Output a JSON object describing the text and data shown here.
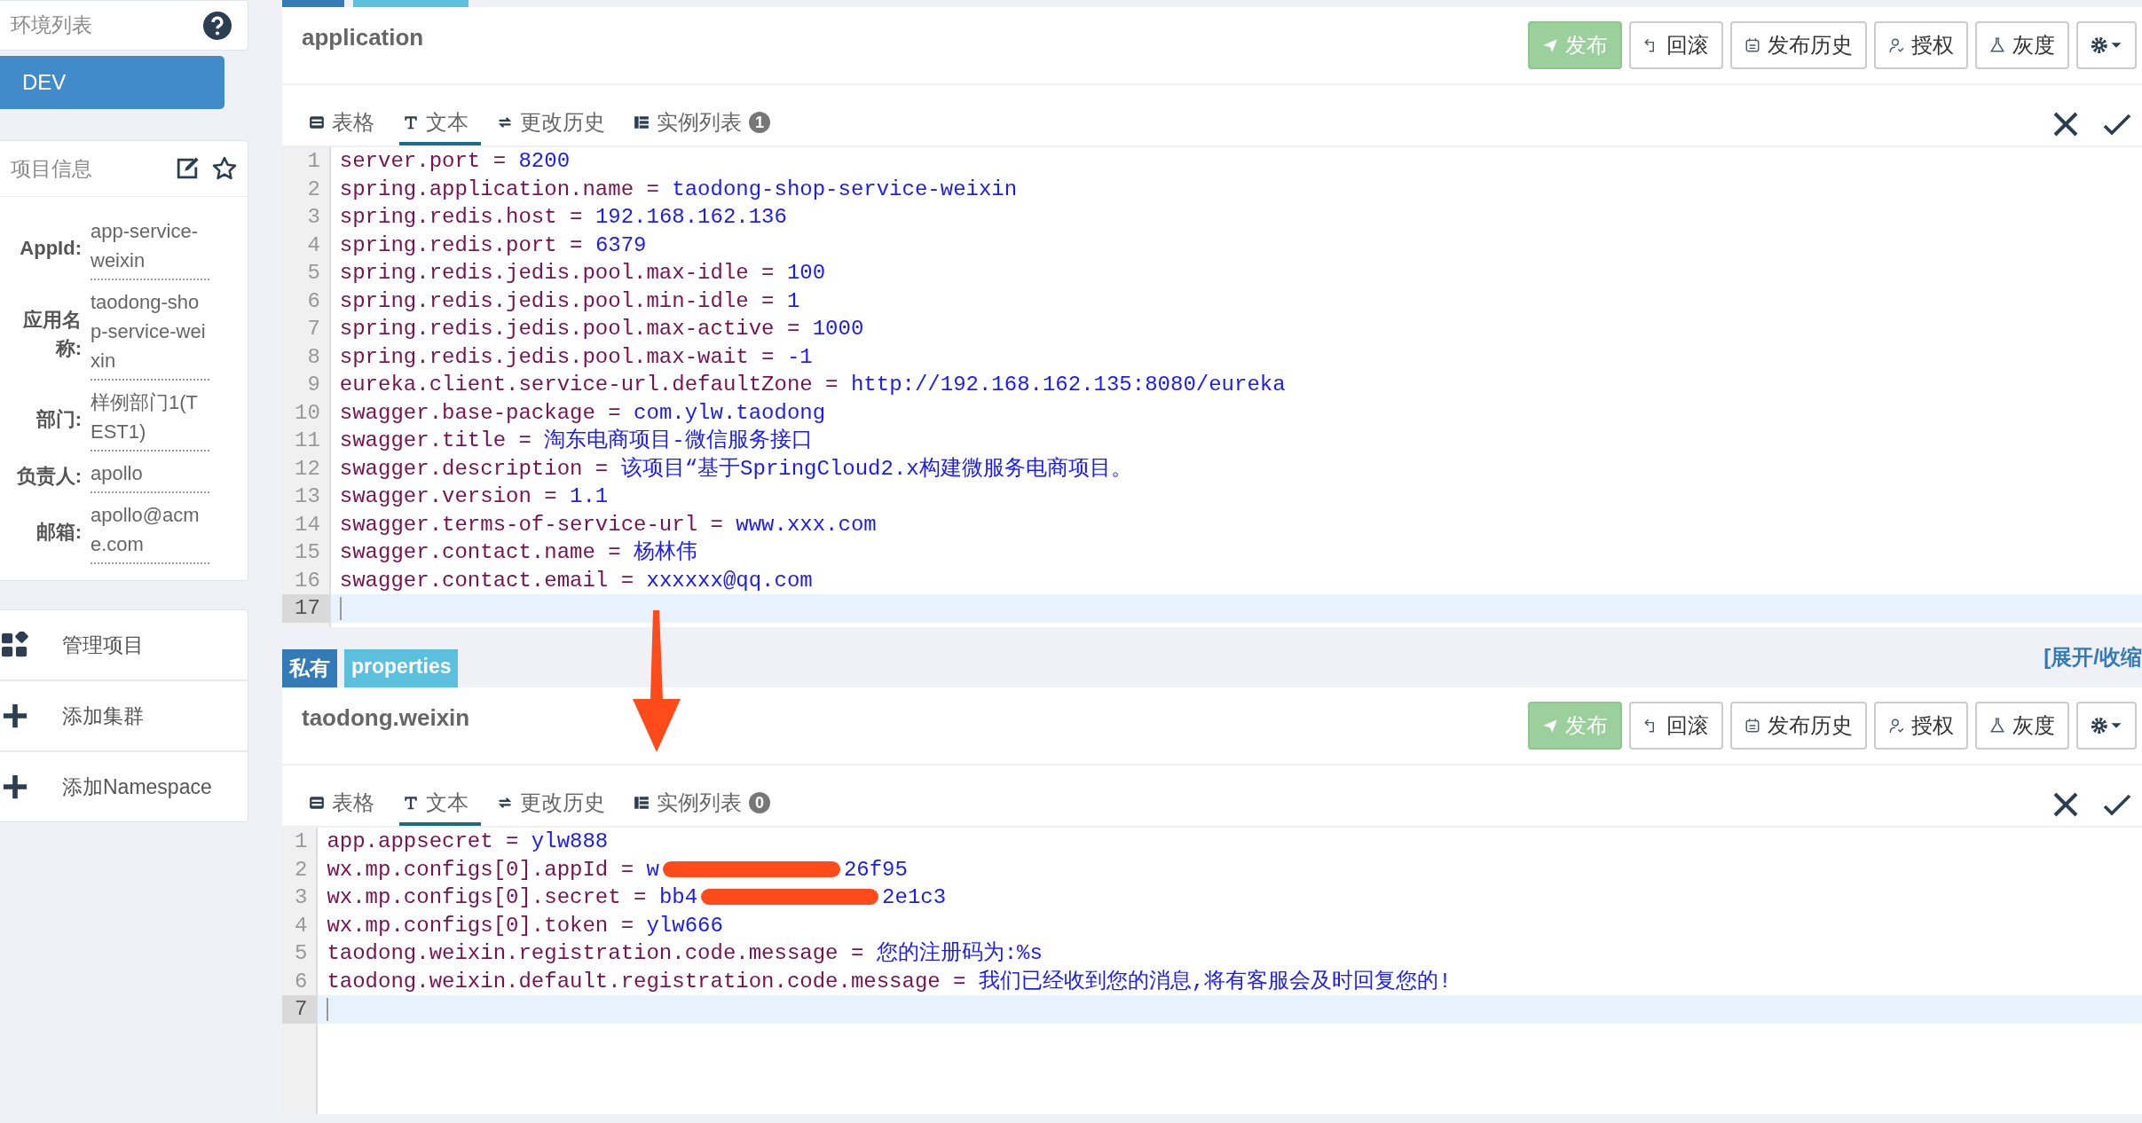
{
  "sidebar": {
    "env_list": {
      "title": "环境列表",
      "items": [
        {
          "label": "DEV",
          "selected": true
        }
      ]
    },
    "project_info": {
      "title": "项目信息",
      "fields": [
        {
          "label": "AppId:",
          "value": "app-service-weixin"
        },
        {
          "label": "应用名称:",
          "value": "taodong-shop-service-weixin"
        },
        {
          "label": "部门:",
          "value": "样例部门1(TEST1)"
        },
        {
          "label": "负责人:",
          "value": "apollo"
        },
        {
          "label": "邮箱:",
          "value": "apollo@acme.com"
        }
      ]
    },
    "actions": [
      {
        "label": "管理项目",
        "kind": "grid"
      },
      {
        "label": "添加集群",
        "kind": "plus"
      },
      {
        "label": "添加Namespace",
        "kind": "plus"
      }
    ]
  },
  "namespaces": [
    {
      "title": "application",
      "buttons": [
        {
          "label": "发布",
          "kind": "primary"
        },
        {
          "label": "回滚",
          "kind": "default"
        },
        {
          "label": "发布历史",
          "kind": "default"
        },
        {
          "label": "授权",
          "kind": "default"
        },
        {
          "label": "灰度",
          "kind": "default"
        },
        {
          "kind": "settings"
        }
      ],
      "tabs": [
        {
          "label": "表格",
          "selected": false
        },
        {
          "label": "文本",
          "selected": true
        },
        {
          "label": "更改历史",
          "selected": false
        },
        {
          "label": "实例列表",
          "selected": false,
          "badge": "1"
        }
      ],
      "lines": [
        {
          "number": "1",
          "key": "server.port =",
          "value": "8200",
          "current": false
        },
        {
          "number": "2",
          "key": "spring.application.name =",
          "value": "taodong-shop-service-weixin",
          "current": false
        },
        {
          "number": "3",
          "key": "spring.redis.host =",
          "value": "192.168.162.136",
          "current": false
        },
        {
          "number": "4",
          "key": "spring.redis.port =",
          "value": "6379",
          "current": false
        },
        {
          "number": "5",
          "key": "spring.redis.jedis.pool.max-idle =",
          "value": "100",
          "current": false
        },
        {
          "number": "6",
          "key": "spring.redis.jedis.pool.min-idle =",
          "value": "1",
          "current": false
        },
        {
          "number": "7",
          "key": "spring.redis.jedis.pool.max-active =",
          "value": "1000",
          "current": false
        },
        {
          "number": "8",
          "key": "spring.redis.jedis.pool.max-wait =",
          "value": "-1",
          "current": false
        },
        {
          "number": "9",
          "key": "eureka.client.service-url.defaultZone =",
          "value": "http://192.168.162.135:8080/eureka",
          "current": false
        },
        {
          "number": "10",
          "key": "swagger.base-package =",
          "value": "com.ylw.taodong",
          "current": false
        },
        {
          "number": "11",
          "key": "swagger.title =",
          "value": "淘东电商项目-微信服务接口",
          "current": false
        },
        {
          "number": "12",
          "key": "swagger.description =",
          "value": "该项目“基于SpringCloud2.x构建微服务电商项目。",
          "current": false
        },
        {
          "number": "13",
          "key": "swagger.version =",
          "value": "1.1",
          "current": false
        },
        {
          "number": "14",
          "key": "swagger.terms-of-service-url =",
          "value": "www.xxx.com",
          "current": false
        },
        {
          "number": "15",
          "key": "swagger.contact.name =",
          "value": "杨林伟",
          "current": false
        },
        {
          "number": "16",
          "key": "swagger.contact.email =",
          "value": "xxxxxx@qq.com",
          "current": false
        },
        {
          "number": "17",
          "current": true
        }
      ]
    },
    {
      "badges": [
        {
          "label": "私有",
          "kind": "scope"
        },
        {
          "label": "properties",
          "kind": "format"
        }
      ],
      "expand_link": "[展开/收缩",
      "title": "taodong.weixin",
      "buttons": [
        {
          "label": "发布",
          "kind": "primary"
        },
        {
          "label": "回滚",
          "kind": "default"
        },
        {
          "label": "发布历史",
          "kind": "default"
        },
        {
          "label": "授权",
          "kind": "default"
        },
        {
          "label": "灰度",
          "kind": "default"
        },
        {
          "kind": "settings"
        }
      ],
      "tabs": [
        {
          "label": "表格",
          "selected": false
        },
        {
          "label": "文本",
          "selected": true
        },
        {
          "label": "更改历史",
          "selected": false
        },
        {
          "label": "实例列表",
          "selected": false,
          "badge": "0"
        }
      ],
      "lines": [
        {
          "number": "1",
          "key": "app.appsecret =",
          "value": "ylw888",
          "current": false
        },
        {
          "number": "2",
          "key": "wx.mp.configs[0].appId =",
          "value": "w",
          "redacted": true,
          "value_tail": "26f95",
          "current": false
        },
        {
          "number": "3",
          "key": "wx.mp.configs[0].secret =",
          "value": "bb4",
          "redacted": true,
          "value_tail": "2e1c3",
          "current": false
        },
        {
          "number": "4",
          "key": "wx.mp.configs[0].token =",
          "value": "ylw666",
          "current": false
        },
        {
          "number": "5",
          "key": "taodong.weixin.registration.code.message =",
          "value": "您的注册码为:%s",
          "current": false
        },
        {
          "number": "6",
          "key": "taodong.weixin.default.registration.code.message =",
          "value": "我们已经收到您的消息,将有客服会及时回复您的!",
          "current": false
        },
        {
          "number": "7",
          "current": true
        }
      ]
    }
  ]
}
